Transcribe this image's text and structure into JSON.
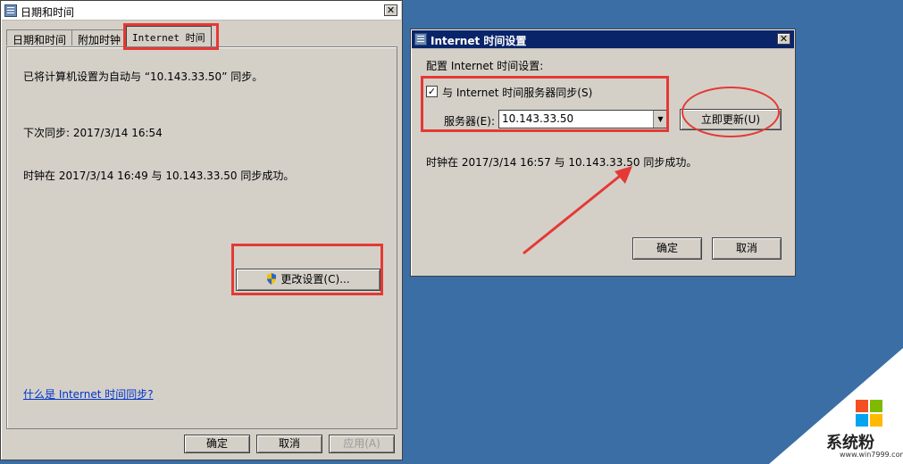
{
  "left_window": {
    "title": "日期和时间",
    "tabs": [
      {
        "label": "日期和时间"
      },
      {
        "label": "附加时钟"
      },
      {
        "label": "Internet 时间"
      }
    ],
    "sync_status": "已将计算机设置为自动与 “10.143.33.50” 同步。",
    "next_sync": "下次同步: 2017/3/14 16:54",
    "last_sync": "时钟在 2017/3/14 16:49 与 10.143.33.50 同步成功。",
    "change_settings_label": "更改设置(C)...",
    "help_link": "什么是 Internet 时间同步?",
    "ok_label": "确定",
    "cancel_label": "取消",
    "apply_label": "应用(A)"
  },
  "right_window": {
    "title": "Internet 时间设置",
    "config_label": "配置 Internet 时间设置:",
    "sync_checkbox_label": "与 Internet 时间服务器同步(S)",
    "sync_checked": true,
    "server_label": "服务器(E):",
    "server_value": "10.143.33.50",
    "update_now_label": "立即更新(U)",
    "result_text": "时钟在 2017/3/14 16:57 与 10.143.33.50 同步成功。",
    "ok_label": "确定",
    "cancel_label": "取消"
  },
  "watermark": {
    "brand": "系统粉",
    "url": "www.win7999.com",
    "colors": [
      "#f25022",
      "#7fba00",
      "#00a4ef",
      "#ffb900"
    ]
  },
  "colors": {
    "desktop": "#3a6ea5",
    "dialog": "#d4d0c8",
    "annotation": "#e53935",
    "link": "#0033cc"
  }
}
